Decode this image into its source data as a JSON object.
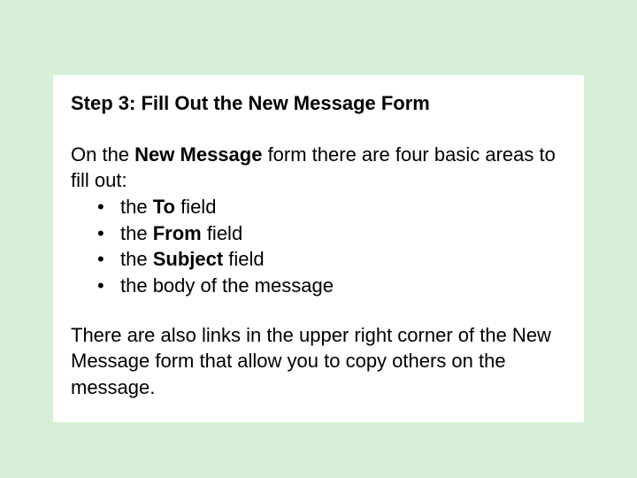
{
  "card": {
    "title": "Step 3: Fill Out the New Message Form",
    "intro_pre": "On the ",
    "intro_bold": "New Message",
    "intro_post": " form there are four basic areas to fill out:",
    "bullets": [
      {
        "pre": "the ",
        "bold": "To",
        "post": " field"
      },
      {
        "pre": "the ",
        "bold": "From",
        "post": " field"
      },
      {
        "pre": "the ",
        "bold": "Subject",
        "post": " field"
      },
      {
        "pre": "the body of the message",
        "bold": "",
        "post": ""
      }
    ],
    "outro": "There are also links in the upper right corner of the New Message form that allow you to copy others on the message."
  }
}
